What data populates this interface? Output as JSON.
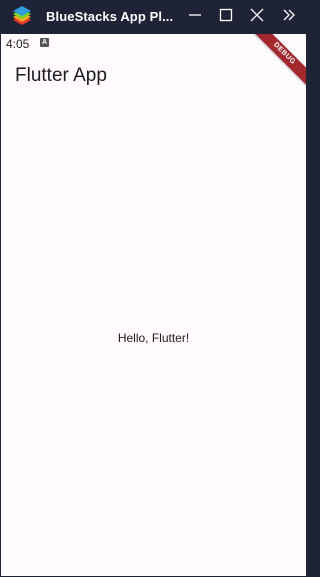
{
  "window": {
    "title": "BlueStacks App Pl...",
    "colors": {
      "titlebar_bg": "#1f2337",
      "screen_bg": "#fffbfe",
      "debug_banner": "#a3292e"
    },
    "controls": {
      "minimize_icon": "minimize-icon",
      "maximize_icon": "maximize-icon",
      "close_icon": "close-icon",
      "more_icon": "double-chevron-right-icon"
    }
  },
  "statusbar": {
    "time": "4:05",
    "notification_icon": "A"
  },
  "app": {
    "title": "Flutter App",
    "body_text": "Hello, Flutter!",
    "debug_banner": "DEBUG"
  }
}
